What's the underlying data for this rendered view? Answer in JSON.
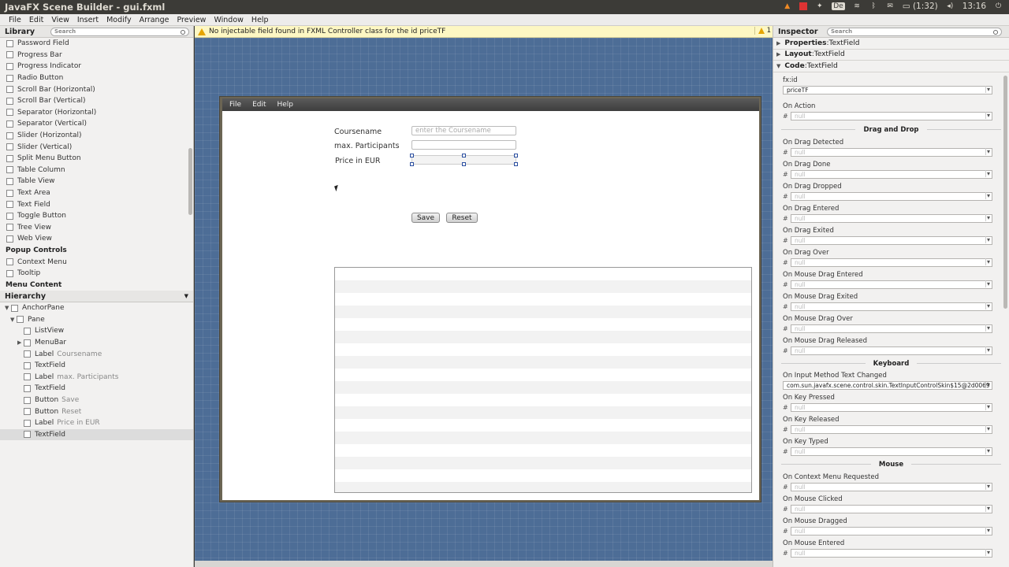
{
  "os": {
    "window_title": "JavaFX Scene Builder - gui.fxml",
    "battery": "(1:32)",
    "clock": "13:16",
    "keyboard_layout": "De"
  },
  "menubar": [
    "File",
    "Edit",
    "View",
    "Insert",
    "Modify",
    "Arrange",
    "Preview",
    "Window",
    "Help"
  ],
  "library": {
    "title": "Library",
    "search_placeholder": "Search",
    "items": [
      "Password Field",
      "Progress Bar",
      "Progress Indicator",
      "Radio Button",
      "Scroll Bar (Horizontal)",
      "Scroll Bar (Vertical)",
      "Separator (Horizontal)",
      "Separator (Vertical)",
      "Slider (Horizontal)",
      "Slider (Vertical)",
      "Split Menu Button",
      "Table Column",
      "Table View",
      "Text Area",
      "Text Field",
      "Toggle Button",
      "Tree View",
      "Web View"
    ],
    "section_popup": "Popup Controls",
    "popup_items": [
      "Context Menu",
      "Tooltip"
    ],
    "section_menu": "Menu Content"
  },
  "hierarchy": {
    "title": "Hierarchy",
    "items": [
      {
        "type": "AnchorPane",
        "sub": ""
      },
      {
        "type": "Pane",
        "sub": ""
      },
      {
        "type": "ListView",
        "sub": ""
      },
      {
        "type": "MenuBar",
        "sub": ""
      },
      {
        "type": "Label",
        "sub": "Coursename"
      },
      {
        "type": "TextField",
        "sub": ""
      },
      {
        "type": "Label",
        "sub": "max. Participants"
      },
      {
        "type": "TextField",
        "sub": ""
      },
      {
        "type": "Button",
        "sub": "Save"
      },
      {
        "type": "Button",
        "sub": "Reset"
      },
      {
        "type": "Label",
        "sub": "Price in EUR"
      },
      {
        "type": "TextField",
        "sub": ""
      }
    ]
  },
  "warning": {
    "message": "No injectable field found in FXML Controller class for the id priceTF",
    "count": "1"
  },
  "form": {
    "menus": [
      "File",
      "Edit",
      "Help"
    ],
    "label_coursename": "Coursename",
    "placeholder_coursename": "enter the Coursename",
    "label_participants": "max. Participants",
    "label_price": "Price in EUR",
    "save_label": "Save",
    "reset_label": "Reset"
  },
  "inspector": {
    "title": "Inspector",
    "search_placeholder": "Search",
    "sections": [
      {
        "name": "Properties",
        "sub": "TextField"
      },
      {
        "name": "Layout",
        "sub": "TextField"
      },
      {
        "name": "Code",
        "sub": "TextField"
      }
    ],
    "fxid_label": "fx:id",
    "fxid_value": "priceTF",
    "on_action_label": "On Action",
    "null_text": "null",
    "drag_group": "Drag and Drop",
    "drag_props": [
      "On Drag Detected",
      "On Drag Done",
      "On Drag Dropped",
      "On Drag Entered",
      "On Drag Exited",
      "On Drag Over",
      "On Mouse Drag Entered",
      "On Mouse Drag Exited",
      "On Mouse Drag Over",
      "On Mouse Drag Released"
    ],
    "keyboard_group": "Keyboard",
    "input_method_label": "On Input Method Text Changed",
    "input_method_value": "com.sun.javafx.scene.control.skin.TextInputControlSkin$15@2d0069",
    "key_props": [
      "On Key Pressed",
      "On Key Released",
      "On Key Typed"
    ],
    "mouse_group": "Mouse",
    "mouse_props": [
      "On Context Menu Requested",
      "On Mouse Clicked",
      "On Mouse Dragged",
      "On Mouse Entered"
    ]
  }
}
